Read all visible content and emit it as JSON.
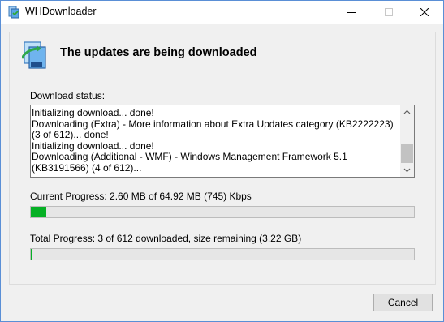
{
  "window": {
    "title": "WHDownloader"
  },
  "header": {
    "title": "The updates are being downloaded"
  },
  "status": {
    "label": "Download status:",
    "log": [
      "Initializing download...  done!",
      "Downloading (Extra) - More information about Extra Updates category (KB2222223) (3 of 612)... done!",
      "Initializing download...  done!",
      "Downloading (Additional - WMF) - Windows Management Framework 5.1 (KB3191566) (4 of 612)..."
    ]
  },
  "current_progress": {
    "label": "Current Progress: 2.60 MB of 64.92 MB (745) Kbps",
    "fraction": 0.04
  },
  "total_progress": {
    "label": "Total Progress: 3 of 612 downloaded, size remaining (3.22 GB)",
    "fraction": 0.005
  },
  "buttons": {
    "cancel": "Cancel"
  },
  "colors": {
    "progress_fill": "#06b025",
    "window_border": "#5a8fd6"
  },
  "icons": {
    "app": "app-update-icon",
    "header": "update-package-icon"
  }
}
